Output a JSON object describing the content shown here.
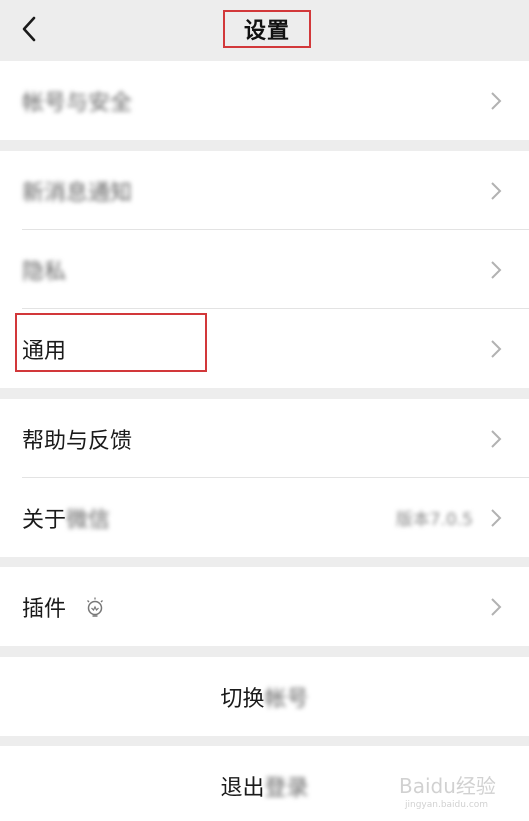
{
  "header": {
    "title": "设置"
  },
  "groups": {
    "account": {
      "label": "帐号与安全"
    },
    "notify": {
      "notifications_label": "新消息通知",
      "privacy_label": "隐私",
      "general_label": "通用"
    },
    "help": {
      "feedback_label": "帮助与反馈",
      "about_label_prefix": "关于",
      "about_label_blurred": "微信",
      "about_value": "版本7.0.5"
    },
    "plugins": {
      "label": "插件"
    },
    "switch": {
      "label_prefix": "切换",
      "label_blurred": "帐号"
    },
    "logout": {
      "label_prefix": "退出",
      "label_blurred": "登录"
    }
  },
  "watermark": {
    "text": "Baidu经验",
    "sub": "jingyan.baidu.com"
  },
  "colors": {
    "background": "#ededed",
    "highlight_border": "#d2383a",
    "chevron": "#b2b2b2"
  },
  "icons": {
    "back": "chevron-left-icon",
    "row_arrow": "chevron-right-icon",
    "plugin": "lightbulb-icon"
  }
}
